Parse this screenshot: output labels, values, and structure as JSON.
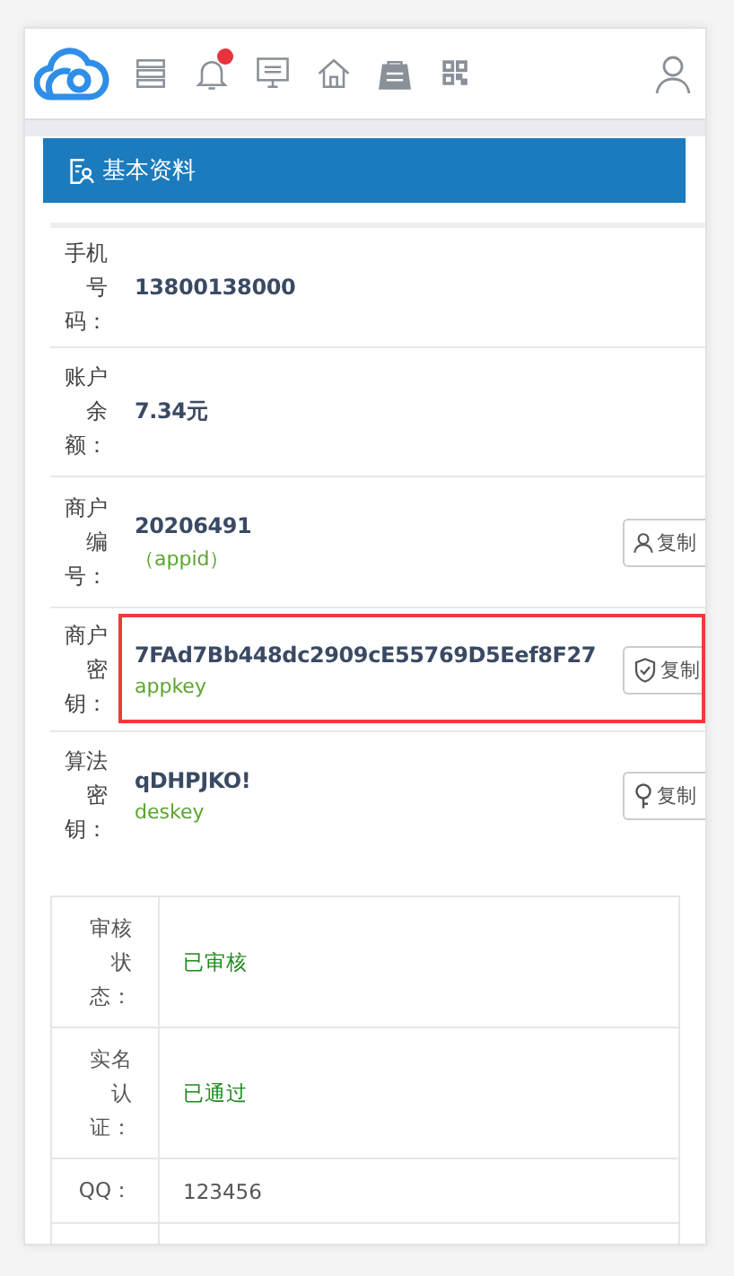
{
  "nav": {
    "notification_badge": true
  },
  "section": {
    "title": "基本资料"
  },
  "fields": [
    {
      "label": "手机号码：",
      "value": "13800138000",
      "highlighted": false
    },
    {
      "label": "账户余额：",
      "value": "7.34元",
      "highlighted": false
    },
    {
      "label": "商户编号：",
      "value": "20206491",
      "hint": "（appid）",
      "button": {
        "label": "复制"
      },
      "highlighted": false
    },
    {
      "label": "商户密钥：",
      "value": "7FAd7Bb448dc2909cE55769D5Eef8F27",
      "hint": "appkey",
      "button": {
        "label": "复制"
      },
      "highlighted": true
    },
    {
      "label": "算法密钥：",
      "value": "qDHPJKO!",
      "hint": "deskey",
      "button": {
        "label": "复制"
      },
      "highlighted": false
    }
  ],
  "info_table": [
    {
      "label": "审核状态：",
      "value": "已审核",
      "kind": "status"
    },
    {
      "label": "实名认证：",
      "value": "已通过",
      "kind": "status"
    },
    {
      "label": "QQ：",
      "value": "123456",
      "kind": "plain"
    }
  ]
}
